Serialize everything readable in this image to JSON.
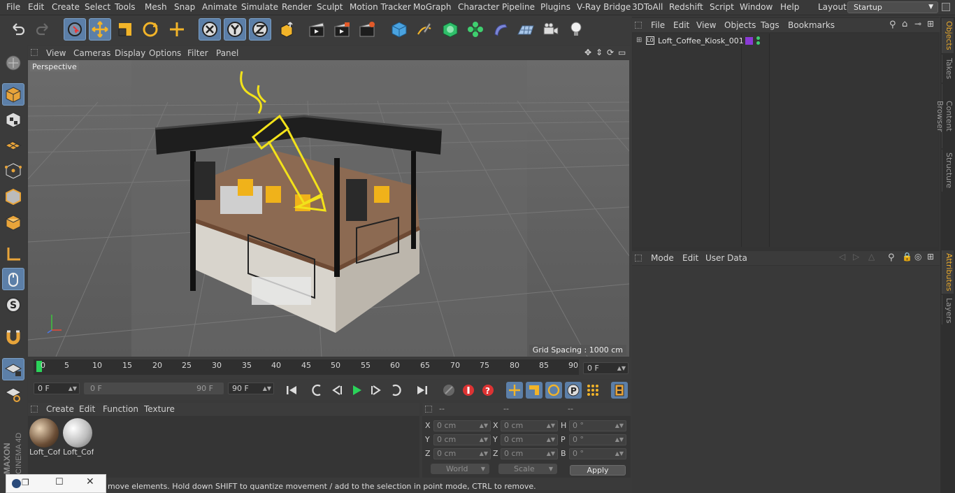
{
  "menubar": {
    "items": [
      "File",
      "Edit",
      "Create",
      "Select",
      "Tools",
      "Mesh",
      "Snap",
      "Animate",
      "Simulate",
      "Render",
      "Sculpt",
      "Motion Tracker",
      "MoGraph",
      "Character",
      "Pipeline",
      "Plugins",
      "V-Ray Bridge",
      "3DToAll",
      "Redshift",
      "Script",
      "Window",
      "Help"
    ],
    "layout_label": "Layout:",
    "layout_value": "Startup"
  },
  "viewport": {
    "menu": [
      "View",
      "Cameras",
      "Display",
      "Options",
      "Filter",
      "Panel"
    ],
    "camera_label": "Perspective",
    "grid_spacing": "Grid Spacing : 1000 cm"
  },
  "timeline": {
    "ticks": [
      "0",
      "5",
      "10",
      "15",
      "20",
      "25",
      "30",
      "35",
      "40",
      "45",
      "50",
      "55",
      "60",
      "65",
      "70",
      "75",
      "80",
      "85",
      "90"
    ],
    "current_frame": "0 F",
    "start_frame": "0 F",
    "range_start": "0 F",
    "range_end": "90 F",
    "end_frame": "90 F"
  },
  "materials": {
    "menu": [
      "Create",
      "Edit",
      "Function",
      "Texture"
    ],
    "items": [
      {
        "label": "Loft_Cof"
      },
      {
        "label": "Loft_Cof"
      }
    ]
  },
  "coordinates": {
    "headers": [
      "--",
      "--",
      "--"
    ],
    "rows": [
      {
        "l1": "X",
        "v1": "0 cm",
        "l2": "X",
        "v2": "0 cm",
        "l3": "H",
        "v3": "0 °"
      },
      {
        "l1": "Y",
        "v1": "0 cm",
        "l2": "Y",
        "v2": "0 cm",
        "l3": "P",
        "v3": "0 °"
      },
      {
        "l1": "Z",
        "v1": "0 cm",
        "l2": "Z",
        "v2": "0 cm",
        "l3": "B",
        "v3": "0 °"
      }
    ],
    "mode_world": "World",
    "mode_scale": "Scale",
    "apply_label": "Apply"
  },
  "status": {
    "text": "move elements. Hold down SHIFT to quantize movement / add to the selection in point mode, CTRL to remove."
  },
  "objects": {
    "menu": [
      "File",
      "Edit",
      "View",
      "Objects",
      "Tags",
      "Bookmarks"
    ],
    "items": [
      {
        "name": "Loft_Coffee_Kiosk_001"
      }
    ]
  },
  "attributes": {
    "menu": [
      "Mode",
      "Edit",
      "User Data"
    ]
  },
  "side_tabs": [
    "Objects",
    "Takes",
    "Content Browser",
    "Structure",
    "Attributes",
    "Layers"
  ],
  "brand": {
    "maxon": "MAXON",
    "cinema": "CINEMA 4D"
  },
  "colors": {
    "accent": "#5c7fa8",
    "playhead": "#2bd35a",
    "neon": "#f2e21a",
    "tab_active": "#e7a82b"
  }
}
